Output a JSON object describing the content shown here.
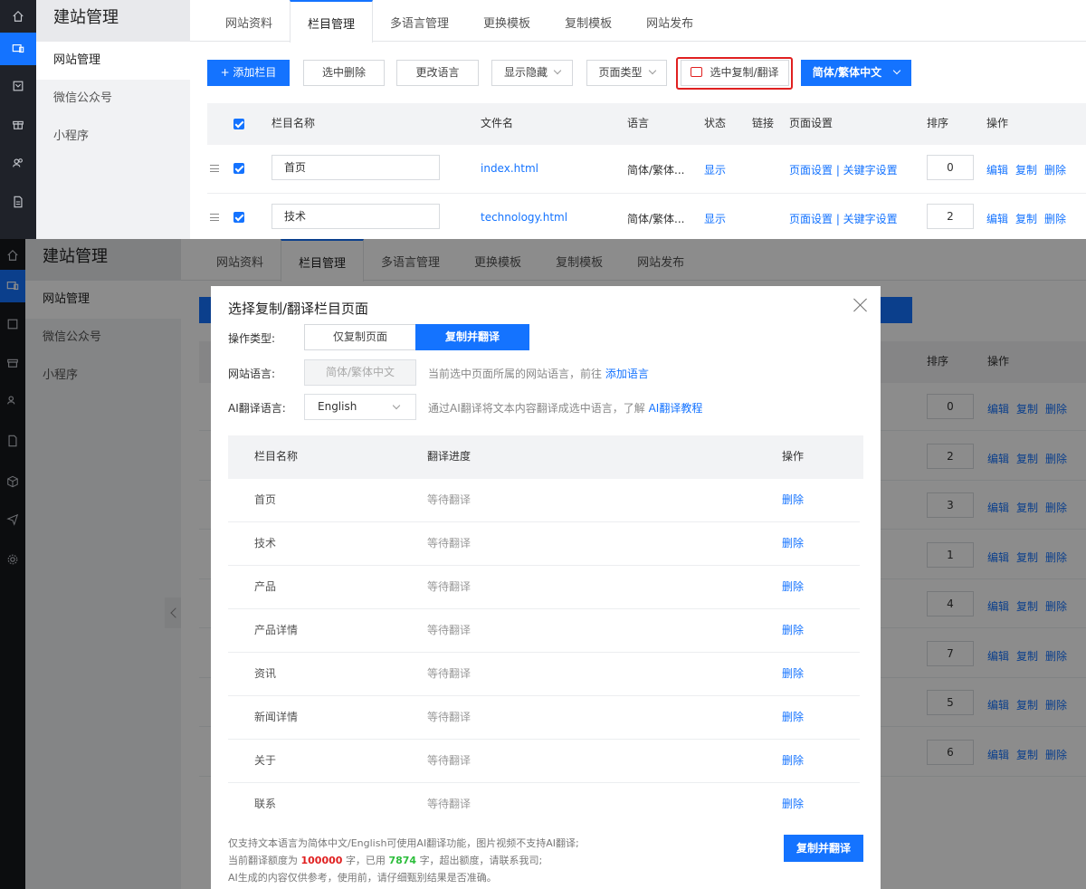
{
  "brand": "建站管理",
  "sidebar": {
    "items": [
      {
        "label": "网站管理"
      },
      {
        "label": "微信公众号"
      },
      {
        "label": "小程序"
      }
    ]
  },
  "tabs": [
    {
      "label": "网站资料"
    },
    {
      "label": "栏目管理"
    },
    {
      "label": "多语言管理"
    },
    {
      "label": "更换模板"
    },
    {
      "label": "复制模板"
    },
    {
      "label": "网站发布"
    }
  ],
  "toolbar": {
    "add": "+ 添加栏目",
    "delete_sel": "选中删除",
    "change_lang": "更改语言",
    "show_hide": "显示隐藏",
    "page_type": "页面类型",
    "copy_translate": "选中复制/翻译",
    "lang_select": "简体/繁体中文"
  },
  "table": {
    "headers": {
      "name": "栏目名称",
      "file": "文件名",
      "lang": "语言",
      "status": "状态",
      "link": "链接",
      "page_settings": "页面设置",
      "order": "排序",
      "actions": "操作"
    },
    "rows": [
      {
        "name": "首页",
        "file": "index.html",
        "lang": "简体/繁体...",
        "status": "显示",
        "settings": "页面设置 | 关键字设置",
        "order": "0"
      },
      {
        "name": "技术",
        "file": "technology.html",
        "lang": "简体/繁体...",
        "status": "显示",
        "settings": "页面设置 | 关键字设置",
        "order": "2"
      }
    ],
    "ops": {
      "edit": "编辑",
      "copy": "复制",
      "del": "删除"
    }
  },
  "bg_orders": [
    "0",
    "2",
    "3",
    "1",
    "4",
    "7",
    "5",
    "6"
  ],
  "modal": {
    "title": "选择复制/翻译栏目页面",
    "op_type_label": "操作类型:",
    "op_copy_only": "仅复制页面",
    "op_copy_translate": "复制并翻译",
    "site_lang_label": "网站语言:",
    "site_lang_value": "简体/繁体中文",
    "site_lang_hint": "当前选中页面所属的网站语言，前往",
    "site_lang_link": "添加语言",
    "ai_lang_label": "AI翻译语言:",
    "ai_lang_value": "English",
    "ai_lang_hint": "通过AI翻译将文本内容翻译成选中语言，了解",
    "ai_lang_link": "AI翻译教程",
    "headers": {
      "name": "栏目名称",
      "progress": "翻译进度",
      "action": "操作"
    },
    "rows": [
      {
        "name": "首页",
        "progress": "等待翻译",
        "action": "删除"
      },
      {
        "name": "技术",
        "progress": "等待翻译",
        "action": "删除"
      },
      {
        "name": "产品",
        "progress": "等待翻译",
        "action": "删除"
      },
      {
        "name": "产品详情",
        "progress": "等待翻译",
        "action": "删除"
      },
      {
        "name": "资讯",
        "progress": "等待翻译",
        "action": "删除"
      },
      {
        "name": "新闻详情",
        "progress": "等待翻译",
        "action": "删除"
      },
      {
        "name": "关于",
        "progress": "等待翻译",
        "action": "删除"
      },
      {
        "name": "联系",
        "progress": "等待翻译",
        "action": "删除"
      }
    ],
    "foot_line1": "仅支持文本语言为简体中文/English可使用AI翻译功能，图片视频不支持AI翻译;",
    "foot_line2_a": "当前翻译额度为",
    "quota": "100000",
    "foot_line2_b": "字，已用",
    "used": "7874",
    "foot_line2_c": "字，超出额度，请联系我司;",
    "foot_line3": "AI生成的内容仅供参考，使用前，请仔细甄别结果是否准确。",
    "submit": "复制并翻译"
  },
  "colors": {
    "accent": "#1473ff",
    "highlight": "#e02020",
    "used": "#2dbe3c"
  }
}
